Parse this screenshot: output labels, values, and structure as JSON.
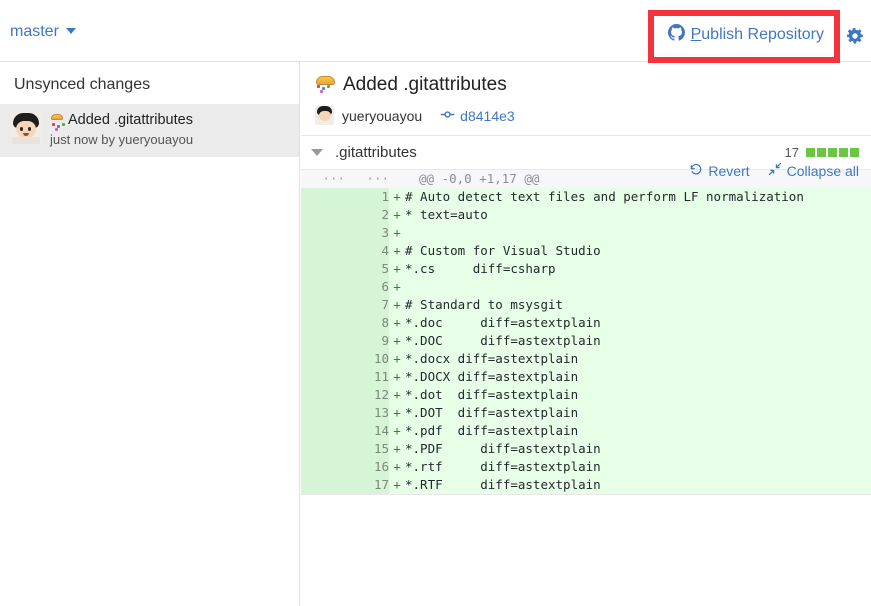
{
  "window": {
    "maximize_icon": "maximize-icon",
    "close_icon": "close-icon"
  },
  "toolbar": {
    "branch_label": "master",
    "branch_caret_icon": "chevron-down-icon",
    "publish_accel": "P",
    "publish_label_rest": "ublish Repository",
    "publish_icon": "github-mark-icon",
    "settings_icon": "gear-icon",
    "annotation_color": "#f5333f"
  },
  "sidebar": {
    "section_title": "Unsynced changes",
    "commits": [
      {
        "avatar_icon": "user-avatar",
        "emoji": "tada-emoji",
        "title": "Added .gitattributes",
        "subtitle": "just now by yueryouayou"
      }
    ]
  },
  "main": {
    "commit": {
      "emoji": "tada-emoji",
      "title": "Added .gitattributes",
      "author_avatar_icon": "user-avatar",
      "author": "yueryouayou",
      "sha_icon": "commit-node-icon",
      "sha": "d8414e3"
    },
    "actions": {
      "revert_icon": "undo-arrow-icon",
      "revert_label": "Revert",
      "collapse_icon": "collapse-arrows-icon",
      "collapse_label": "Collapse all"
    },
    "file": {
      "collapse_icon": "triangle-down-icon",
      "name": ".gitattributes",
      "stat_count": "17",
      "stat_squares": 5,
      "stat_color": "#6cc644",
      "hunk_old_marker": "···",
      "hunk_new_marker": "···",
      "hunk_header": "@@ -0,0 +1,17 @@",
      "lines": [
        {
          "num": "1",
          "sign": "+",
          "code": "# Auto detect text files and perform LF normalization"
        },
        {
          "num": "2",
          "sign": "+",
          "code": "* text=auto"
        },
        {
          "num": "3",
          "sign": "+",
          "code": ""
        },
        {
          "num": "4",
          "sign": "+",
          "code": "# Custom for Visual Studio"
        },
        {
          "num": "5",
          "sign": "+",
          "code": "*.cs     diff=csharp"
        },
        {
          "num": "6",
          "sign": "+",
          "code": ""
        },
        {
          "num": "7",
          "sign": "+",
          "code": "# Standard to msysgit"
        },
        {
          "num": "8",
          "sign": "+",
          "code": "*.doc     diff=astextplain"
        },
        {
          "num": "9",
          "sign": "+",
          "code": "*.DOC     diff=astextplain"
        },
        {
          "num": "10",
          "sign": "+",
          "code": "*.docx diff=astextplain"
        },
        {
          "num": "11",
          "sign": "+",
          "code": "*.DOCX diff=astextplain"
        },
        {
          "num": "12",
          "sign": "+",
          "code": "*.dot  diff=astextplain"
        },
        {
          "num": "13",
          "sign": "+",
          "code": "*.DOT  diff=astextplain"
        },
        {
          "num": "14",
          "sign": "+",
          "code": "*.pdf  diff=astextplain"
        },
        {
          "num": "15",
          "sign": "+",
          "code": "*.PDF     diff=astextplain"
        },
        {
          "num": "16",
          "sign": "+",
          "code": "*.rtf     diff=astextplain"
        },
        {
          "num": "17",
          "sign": "+",
          "code": "*.RTF     diff=astextplain"
        }
      ]
    }
  }
}
